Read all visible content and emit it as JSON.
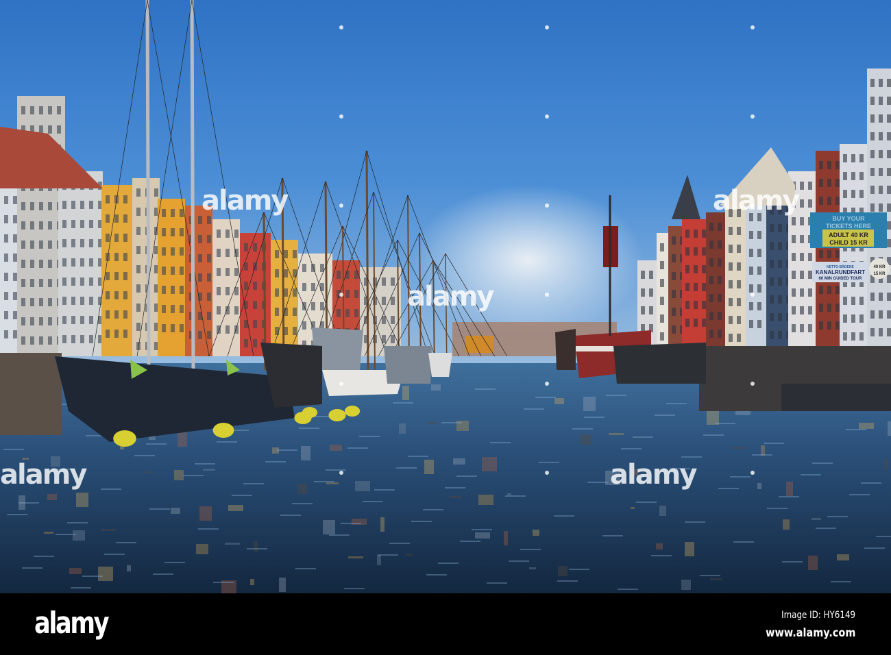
{
  "photo": {
    "subject": "Nyhavn canal with moored sailing ships and colourful houses",
    "signs": {
      "ticket_line1": "BUY YOUR",
      "ticket_line2": "TICKETS HERE",
      "adult": "ADULT 40 KR",
      "child": "CHILD 15 KR",
      "operator": "NETTO-BÅDENE",
      "tour_name": "KANALRUNDFART",
      "tour_desc": "60 MIN GUIDED TOUR",
      "price_adult": "40 KR",
      "price_child": "15 KR"
    },
    "watermark": "alamy"
  },
  "footer": {
    "logo": "alamy",
    "image_id": "Image ID: HY6149",
    "url": "www.alamy.com"
  }
}
